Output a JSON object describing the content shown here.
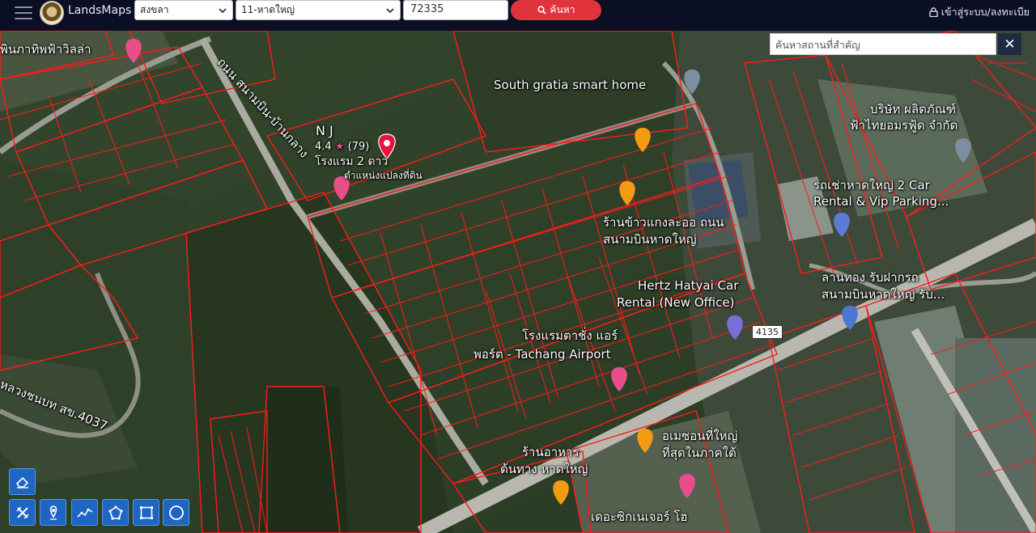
{
  "app": {
    "brand": "LandsMaps",
    "province_value": "สงขลา",
    "district_value": "11-หาดใหญ่",
    "postcode_value": "72335",
    "search_label": "ค้นหา",
    "login_label": "เข้าสู่ระบบ/ลงทะเบีย"
  },
  "map": {
    "place_search_placeholder": "ค้นหาสถานที่สำคัญ",
    "close_label": "✕",
    "route_shield": "4135",
    "labels": {
      "resort": "พินภาทิพฟ้าวิลล่า",
      "road_north": "ถนน สนามบิน-บ้านกลาง",
      "south_gratia": "South gratia smart home",
      "nj_name": "N J",
      "nj_rating": "4.4",
      "nj_count": "(79)",
      "nj_type": "โรงแรม 2 ดาว",
      "parcel_pos": "ตำแหน่งแปลงที่ดิน",
      "company_1": "บริษัท ผลิตภัณฑ์",
      "company_2": "ฟ้าไทยอมรฟู้ด จำกัด",
      "car_rental_1": "รถเช่าหาดใหญ่ 2 Car",
      "car_rental_2": "Rental & Vip Parking...",
      "rice_1": "ร้านข้าวแกงละออ ถนน",
      "rice_2": "สนามบินหาดใหญ่",
      "hertz_1": "Hertz Hatyai Car",
      "hertz_2": "Rental (New Office)",
      "lanthong_1": "ลานทอง รับฝากรถ",
      "lanthong_2": "สนามบินหาดใหญ่ รับ...",
      "hotel_1": "โรงแรมตาชั่ง แอร์",
      "hotel_2": "พอร์ต - Tachang Airport",
      "luang": "หลวงชนบท สข.4037",
      "food_1": "ร้านอาหาร",
      "food_2": "ต้นทาง หาดใหญ่",
      "amazon_1": "อเมซอนที่ใหญ่",
      "amazon_2": "ที่สุดในภาคใต้",
      "bottom": "เดอะซิกเนเจอร์ โฮ"
    }
  },
  "tools": [
    {
      "name": "erase-tool-button",
      "icon": "eraser-icon"
    },
    {
      "name": "clear-tool-button",
      "icon": "ruler-cross-icon"
    },
    {
      "name": "marker-tool-button",
      "icon": "map-pin-icon"
    },
    {
      "name": "line-tool-button",
      "icon": "polyline-icon"
    },
    {
      "name": "polygon-tool-button",
      "icon": "polygon-icon"
    },
    {
      "name": "rectangle-tool-button",
      "icon": "rectangle-icon"
    },
    {
      "name": "circle-tool-button",
      "icon": "circle-icon"
    }
  ],
  "colors": {
    "topbar": "#0a0f23",
    "accent": "#e0333c",
    "parcel": "#ff1a1a",
    "tool": "#1f66c4"
  }
}
